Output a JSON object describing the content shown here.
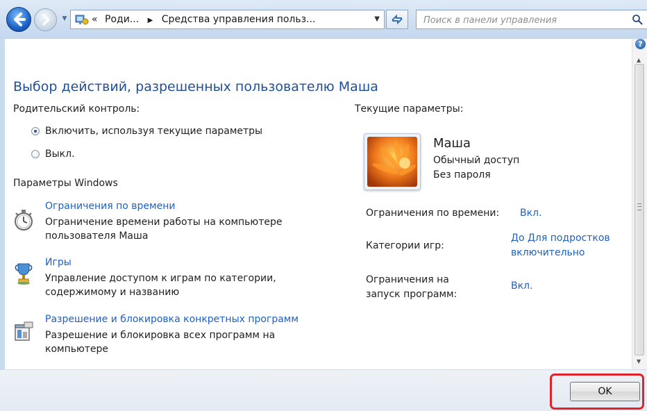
{
  "address_bar": {
    "crumb_prefix": "«",
    "crumbs": [
      "Роди...",
      "Средства управления польз..."
    ],
    "search_placeholder": "Поиск в панели управления"
  },
  "page": {
    "title": "Выбор действий, разрешенных пользователю Маша",
    "parental_control_label": "Родительский контроль:",
    "radio_options": [
      {
        "label": "Включить, используя текущие параметры",
        "checked": true
      },
      {
        "label": "Выкл.",
        "checked": false
      }
    ],
    "windows_settings_label": "Параметры Windows",
    "tasks": [
      {
        "link": "Ограничения по времени",
        "description": "Ограничение времени работы на компьютере пользователя Маша",
        "icon": "stopwatch-icon"
      },
      {
        "link": "Игры",
        "description": "Управление доступом к играм по категории, содержимому и названию",
        "icon": "trophy-icon"
      },
      {
        "link": "Разрешение и блокировка конкретных программ",
        "description": "Разрешение и блокировка всех программ на компьютере",
        "icon": "program-window-icon"
      }
    ]
  },
  "current_settings": {
    "label": "Текущие параметры:",
    "user_name": "Маша",
    "account_type": "Обычный доступ",
    "password_status": "Без пароля",
    "params": [
      {
        "name": "Ограничения по времени:",
        "value": "Вкл."
      },
      {
        "name": "Категории игр:",
        "value": "До Для подростков включительно"
      },
      {
        "name": "Ограничения на запуск программ:",
        "value": "Вкл."
      }
    ]
  },
  "footer": {
    "ok_label": "OK"
  },
  "colors": {
    "title": "#1f4f99",
    "link": "#1e5fc8",
    "highlight": "#e0232a"
  }
}
